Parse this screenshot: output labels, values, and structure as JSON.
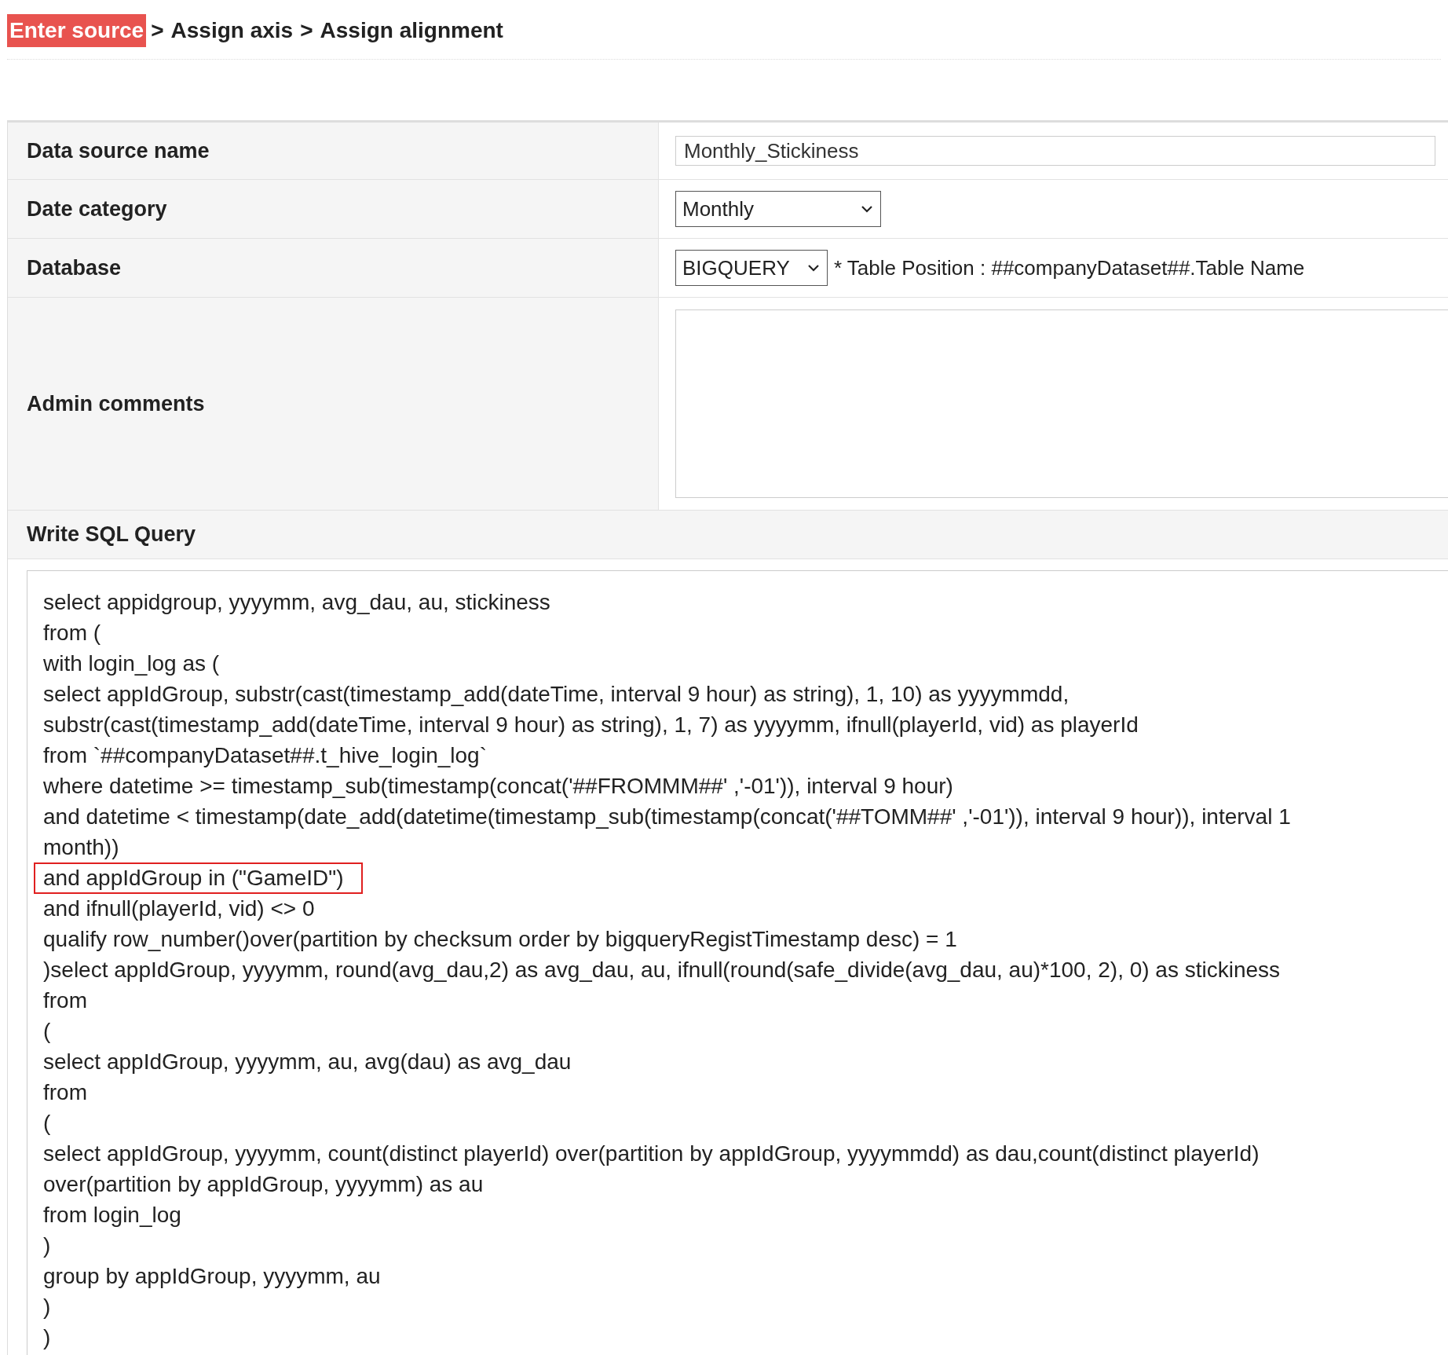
{
  "breadcrumb": [
    {
      "label": "Enter source",
      "selected": true
    },
    {
      "label": "Assign axis",
      "selected": false
    },
    {
      "label": "Assign alignment",
      "selected": false
    }
  ],
  "breadcrumb_separator": ">",
  "form": {
    "rows": [
      {
        "kind": "input",
        "label": "Data source name",
        "value": "Monthly_Stickiness"
      },
      {
        "kind": "select",
        "label": "Date category",
        "value": "Monthly"
      },
      {
        "kind": "select",
        "label": "Database",
        "value": "BIGQUERY",
        "note": "* Table Position : ##companyDataset##.Table Name"
      },
      {
        "kind": "textarea",
        "label": "Admin comments"
      }
    ]
  },
  "sql": {
    "label": "Write SQL Query",
    "lines": [
      {
        "text": "select appidgroup, yyyymm, avg_dau, au, stickiness",
        "highlighted": false
      },
      {
        "text": "from (",
        "highlighted": false
      },
      {
        "text": "with login_log as (",
        "highlighted": false
      },
      {
        "text": "select appIdGroup, substr(cast(timestamp_add(dateTime, interval 9 hour) as string), 1, 10) as yyyymmdd,",
        "highlighted": false
      },
      {
        "text": "substr(cast(timestamp_add(dateTime, interval 9 hour) as string), 1, 7) as yyyymm, ifnull(playerId, vid) as playerId",
        "highlighted": false
      },
      {
        "text": "from `##companyDataset##.t_hive_login_log`",
        "highlighted": false
      },
      {
        "text": "where datetime >= timestamp_sub(timestamp(concat('##FROMMM##' ,'-01')), interval 9 hour)",
        "highlighted": false
      },
      {
        "text": "and datetime < timestamp(date_add(datetime(timestamp_sub(timestamp(concat('##TOMM##' ,'-01')), interval 9 hour)), interval 1",
        "highlighted": false
      },
      {
        "text": "month))",
        "highlighted": false
      },
      {
        "text": "and appIdGroup in (\"GameID\")",
        "highlighted": true
      },
      {
        "text": "and ifnull(playerId, vid) <> 0",
        "highlighted": false
      },
      {
        "text": "qualify row_number()over(partition by checksum order by bigqueryRegistTimestamp desc) = 1",
        "highlighted": false
      },
      {
        "text": ")select appIdGroup, yyyymm, round(avg_dau,2) as avg_dau, au, ifnull(round(safe_divide(avg_dau, au)*100, 2), 0) as stickiness",
        "highlighted": false
      },
      {
        "text": "from",
        "highlighted": false
      },
      {
        "text": "(",
        "highlighted": false
      },
      {
        "text": "select appIdGroup, yyyymm, au, avg(dau) as avg_dau",
        "highlighted": false
      },
      {
        "text": "from",
        "highlighted": false
      },
      {
        "text": "(",
        "highlighted": false
      },
      {
        "text": "select appIdGroup, yyyymm, count(distinct playerId) over(partition by appIdGroup, yyyymmdd) as dau,count(distinct playerId)",
        "highlighted": false
      },
      {
        "text": "over(partition by appIdGroup, yyyymm) as au",
        "highlighted": false
      },
      {
        "text": "from login_log",
        "highlighted": false
      },
      {
        "text": ")",
        "highlighted": false
      },
      {
        "text": "group by appIdGroup, yyyymm, au",
        "highlighted": false
      },
      {
        "text": ")",
        "highlighted": false
      },
      {
        "text": ")",
        "highlighted": false
      }
    ]
  }
}
